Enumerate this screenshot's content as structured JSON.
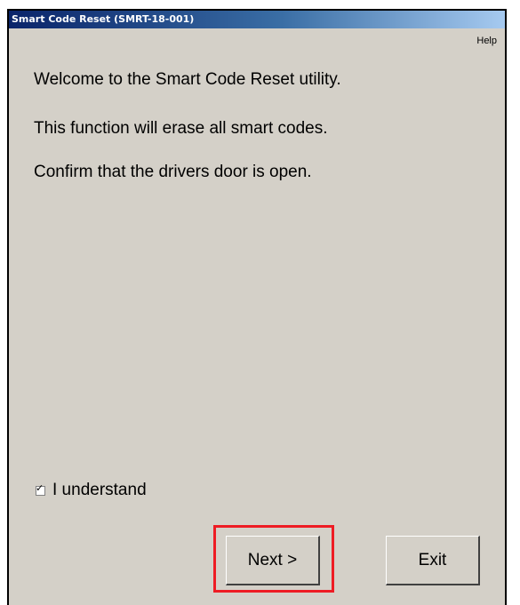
{
  "window": {
    "title": "Smart Code Reset (SMRT-18-001)",
    "help_label": "Help"
  },
  "messages": [
    "Welcome to the Smart Code Reset utility.",
    "This function will erase all smart codes.",
    "Confirm that the drivers door is open."
  ],
  "checkbox": {
    "label": "I understand",
    "checked": true,
    "check_glyph": "✓"
  },
  "buttons": {
    "next_label": "Next >",
    "exit_label": "Exit"
  },
  "colors": {
    "titlebar_start": "#0a246a",
    "titlebar_end": "#a6caf0",
    "window_bg": "#d4d0c8",
    "highlight": "#ee1c24"
  }
}
